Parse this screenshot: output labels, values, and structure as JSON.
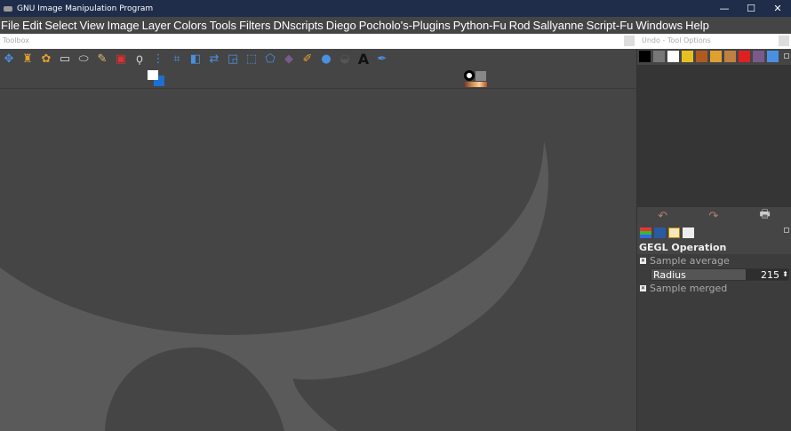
{
  "window": {
    "title": "GNU Image Manipulation Program",
    "minimize": "—",
    "maximize": "☐",
    "close": "✕"
  },
  "menu": [
    "File",
    "Edit",
    "Select",
    "View",
    "Image",
    "Layer",
    "Colors",
    "Tools",
    "Filters",
    "DNscripts",
    "Diego",
    "Pocholo's-Plugins",
    "Python-Fu",
    "Rod",
    "Sallyanne",
    "Script-Fu",
    "Windows",
    "Help"
  ],
  "toolbox": {
    "title": "Toolbox",
    "tools": [
      {
        "name": "move-tool",
        "glyph": "✥",
        "color": "#4a90e2"
      },
      {
        "name": "clone-tool",
        "glyph": "♜",
        "color": "#e0a030"
      },
      {
        "name": "heal-tool",
        "glyph": "✿",
        "color": "#e0a030"
      },
      {
        "name": "rect-select-tool",
        "glyph": "▭",
        "color": "#ddd"
      },
      {
        "name": "ellipse-select-tool",
        "glyph": "⬭",
        "color": "#ddd"
      },
      {
        "name": "fuzzy-select-tool",
        "glyph": "✎",
        "color": "#e0c070"
      },
      {
        "name": "color-select-tool",
        "glyph": "▣",
        "color": "#e03030"
      },
      {
        "name": "lasso-tool",
        "glyph": "ϙ",
        "color": "#ccc"
      },
      {
        "name": "paths-tool",
        "glyph": "⋮",
        "color": "#4a90e2"
      },
      {
        "name": "crop-tool",
        "glyph": "⌗",
        "color": "#4a90e2"
      },
      {
        "name": "flip-tool",
        "glyph": "◧",
        "color": "#4a90e2"
      },
      {
        "name": "unified-transform-tool",
        "glyph": "⇄",
        "color": "#4a90e2"
      },
      {
        "name": "scale-tool",
        "glyph": "◲",
        "color": "#4a90e2"
      },
      {
        "name": "perspective-tool",
        "glyph": "⬚",
        "color": "#4a90e2"
      },
      {
        "name": "cage-tool",
        "glyph": "⬠",
        "color": "#4a90e2"
      },
      {
        "name": "blend-tool",
        "glyph": "◆",
        "color": "#7a5a8a"
      },
      {
        "name": "paintbrush-tool",
        "glyph": "✐",
        "color": "#e0a030"
      },
      {
        "name": "blur-tool",
        "glyph": "●",
        "color": "#4a90e2"
      },
      {
        "name": "smudge-tool",
        "glyph": "◒",
        "color": "#555"
      },
      {
        "name": "text-tool",
        "glyph": "A",
        "color": "#111"
      },
      {
        "name": "color-picker-tool",
        "glyph": "✒",
        "color": "#4a90e2"
      }
    ]
  },
  "right_panel": {
    "title": "Undo - Tool Options",
    "tabs": [
      "brush",
      "pattern",
      "font",
      "undo",
      "gradient",
      "paint",
      "image",
      "color",
      "blend",
      "histogram"
    ],
    "undo_buttons": {
      "undo": "↶",
      "redo": "↷",
      "clear": "🖶"
    },
    "tool_options": {
      "heading": "GEGL Operation",
      "sample_average_label": "Sample average",
      "radius_label": "Radius",
      "radius_value": "215",
      "sample_merged_label": "Sample merged"
    }
  }
}
